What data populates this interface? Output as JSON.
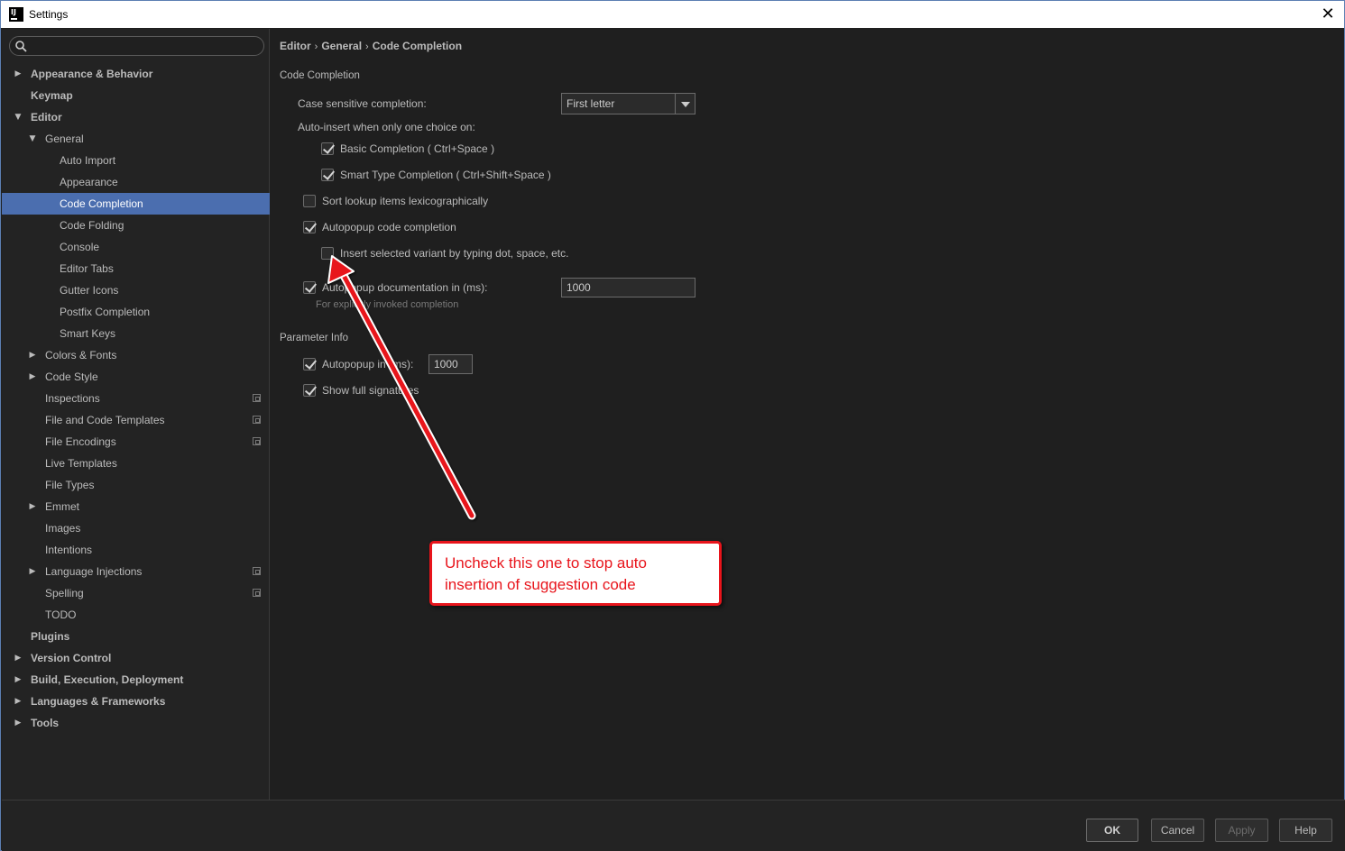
{
  "window": {
    "title": "Settings",
    "close_glyph": "✕"
  },
  "sidebar": {
    "search_placeholder": "",
    "items": [
      {
        "label": "Appearance & Behavior",
        "level": 0,
        "arrow": "▶",
        "bold": true
      },
      {
        "label": "Keymap",
        "level": 0,
        "arrow": "",
        "bold": true
      },
      {
        "label": "Editor",
        "level": 0,
        "arrow": "▼",
        "bold": true
      },
      {
        "label": "General",
        "level": 1,
        "arrow": "▼"
      },
      {
        "label": "Auto Import",
        "level": 2,
        "arrow": ""
      },
      {
        "label": "Appearance",
        "level": 2,
        "arrow": ""
      },
      {
        "label": "Code Completion",
        "level": 2,
        "arrow": "",
        "selected": true
      },
      {
        "label": "Code Folding",
        "level": 2,
        "arrow": ""
      },
      {
        "label": "Console",
        "level": 2,
        "arrow": ""
      },
      {
        "label": "Editor Tabs",
        "level": 2,
        "arrow": ""
      },
      {
        "label": "Gutter Icons",
        "level": 2,
        "arrow": ""
      },
      {
        "label": "Postfix Completion",
        "level": 2,
        "arrow": ""
      },
      {
        "label": "Smart Keys",
        "level": 2,
        "arrow": ""
      },
      {
        "label": "Colors & Fonts",
        "level": 1,
        "arrow": "▶"
      },
      {
        "label": "Code Style",
        "level": 1,
        "arrow": "▶"
      },
      {
        "label": "Inspections",
        "level": 1,
        "arrow": "",
        "project": true
      },
      {
        "label": "File and Code Templates",
        "level": 1,
        "arrow": "",
        "project": true
      },
      {
        "label": "File Encodings",
        "level": 1,
        "arrow": "",
        "project": true
      },
      {
        "label": "Live Templates",
        "level": 1,
        "arrow": ""
      },
      {
        "label": "File Types",
        "level": 1,
        "arrow": ""
      },
      {
        "label": "Emmet",
        "level": 1,
        "arrow": "▶"
      },
      {
        "label": "Images",
        "level": 1,
        "arrow": ""
      },
      {
        "label": "Intentions",
        "level": 1,
        "arrow": ""
      },
      {
        "label": "Language Injections",
        "level": 1,
        "arrow": "▶",
        "project": true
      },
      {
        "label": "Spelling",
        "level": 1,
        "arrow": "",
        "project": true
      },
      {
        "label": "TODO",
        "level": 1,
        "arrow": ""
      },
      {
        "label": "Plugins",
        "level": 0,
        "arrow": "",
        "bold": true
      },
      {
        "label": "Version Control",
        "level": 0,
        "arrow": "▶",
        "bold": true
      },
      {
        "label": "Build, Execution, Deployment",
        "level": 0,
        "arrow": "▶",
        "bold": true
      },
      {
        "label": "Languages & Frameworks",
        "level": 0,
        "arrow": "▶",
        "bold": true
      },
      {
        "label": "Tools",
        "level": 0,
        "arrow": "▶",
        "bold": true
      }
    ]
  },
  "breadcrumb": {
    "parts": [
      "Editor",
      "General",
      "Code Completion"
    ],
    "separator": "›"
  },
  "code_completion": {
    "section_title": "Code Completion",
    "case_sensitive_label": "Case sensitive completion:",
    "case_sensitive_value": "First letter",
    "auto_insert_label": "Auto-insert when only one choice on:",
    "basic_completion": {
      "label": "Basic Completion ( Ctrl+Space )",
      "checked": true
    },
    "smart_type_completion": {
      "label": "Smart Type Completion ( Ctrl+Shift+Space )",
      "checked": true
    },
    "sort_lookup": {
      "label": "Sort lookup items lexicographically",
      "checked": false
    },
    "autopopup_completion": {
      "label": "Autopopup code completion",
      "checked": true
    },
    "insert_selected_variant": {
      "label": "Insert selected variant by typing dot, space, etc.",
      "checked": false
    },
    "autopopup_documentation": {
      "label": "Autopopup documentation in (ms):",
      "checked": true,
      "value": "1000"
    },
    "autopopup_documentation_hint": "For explicitly invoked completion"
  },
  "parameter_info": {
    "section_title": "Parameter Info",
    "autopopup": {
      "label": "Autopopup in (ms):",
      "checked": true,
      "value": "1000"
    },
    "show_full_signatures": {
      "label": "Show full signatures",
      "checked": true
    }
  },
  "buttons": {
    "ok": "OK",
    "cancel": "Cancel",
    "apply": "Apply",
    "help": "Help"
  },
  "annotation": {
    "text_line1": "Uncheck this one to stop auto",
    "text_line2": "insertion of suggestion code",
    "color": "#e8141b"
  },
  "colors": {
    "accent_selection": "#4b6eaf",
    "background": "#1f1f1f"
  }
}
